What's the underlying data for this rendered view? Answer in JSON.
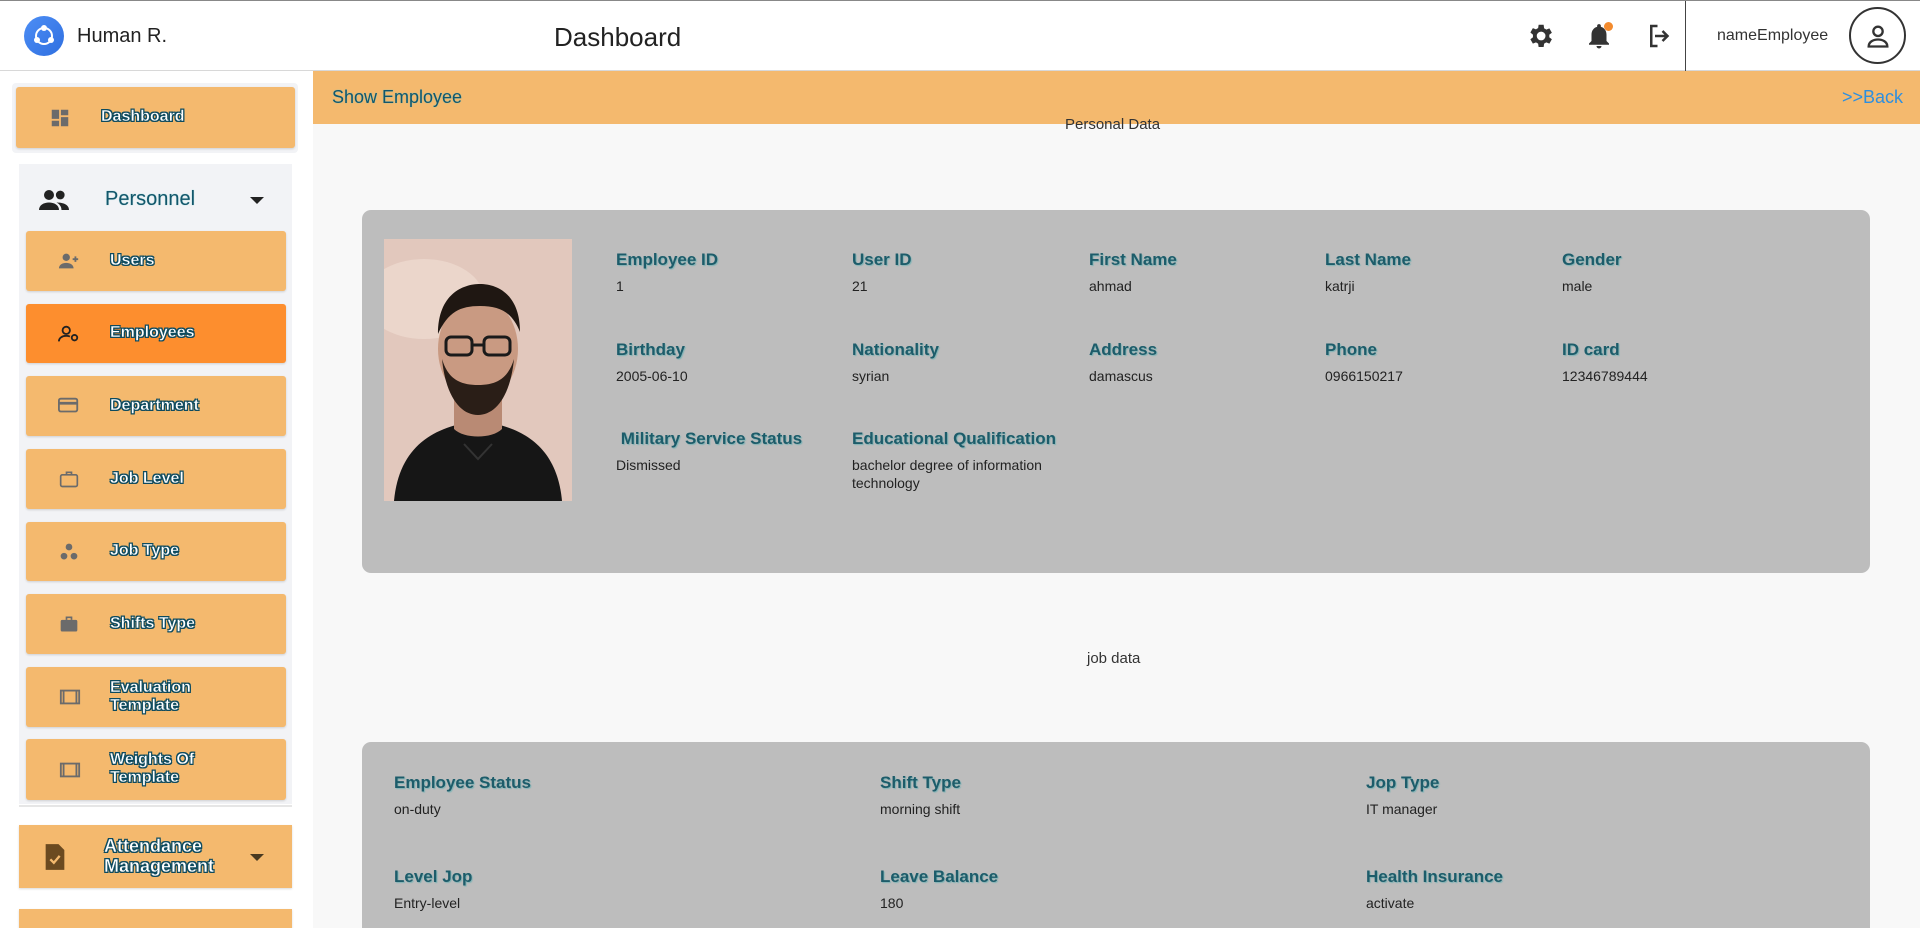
{
  "header": {
    "app_name": "Human R.",
    "page_title": "Dashboard",
    "user_name": "nameEmployee"
  },
  "sidebar": {
    "dashboard_label": "Dashboard",
    "group_label": "Personnel",
    "items": [
      {
        "label": "Users",
        "icon": "add-user-icon"
      },
      {
        "label": "Employees",
        "icon": "employee-settings-icon",
        "active": true
      },
      {
        "label": "Department",
        "icon": "credit-card-icon"
      },
      {
        "label": "Job Level",
        "icon": "briefcase-outline-icon"
      },
      {
        "label": "Job Type",
        "icon": "workspaces-icon"
      },
      {
        "label": "Shifts Type",
        "icon": "briefcase-icon"
      },
      {
        "label": "Evaluation Template",
        "icon": "frame-icon"
      },
      {
        "label": "Weights Of Template",
        "icon": "frame-icon"
      }
    ],
    "group2_label": "Attendance Management"
  },
  "main": {
    "subheader_title": "Show Employee",
    "back_label": ">>Back",
    "personal_section_title": "Personal Data",
    "job_section_title": "job data",
    "personal_fields": [
      {
        "label": "Employee ID",
        "value": "1"
      },
      {
        "label": "User ID",
        "value": "21"
      },
      {
        "label": "First Name",
        "value": "ahmad"
      },
      {
        "label": "Last Name",
        "value": "katrji"
      },
      {
        "label": "Gender",
        "value": "male"
      },
      {
        "label": "Birthday",
        "value": "2005-06-10"
      },
      {
        "label": "Nationality",
        "value": "syrian"
      },
      {
        "label": "Address",
        "value": "damascus"
      },
      {
        "label": "Phone",
        "value": "0966150217"
      },
      {
        "label": "ID card",
        "value": "12346789444"
      },
      {
        "label": " Military Service Status",
        "value": "Dismissed"
      },
      {
        "label": "Educational Qualification",
        "value": "bachelor degree of information technology"
      }
    ],
    "job_fields": [
      {
        "label": "Employee Status",
        "value": "on-duty"
      },
      {
        "label": "Shift Type",
        "value": "morning shift"
      },
      {
        "label": "Jop Type",
        "value": "IT manager"
      },
      {
        "label": "Level Jop",
        "value": "Entry-level"
      },
      {
        "label": "Leave Balance",
        "value": "180"
      },
      {
        "label": "Health Insurance",
        "value": "activate"
      }
    ]
  },
  "colors": {
    "sidebar_button": "#f4b96e",
    "sidebar_active": "#fd8e2e",
    "card": "#bdbdbd",
    "accent_teal": "#1d5c6a",
    "link": "#2d8fe0"
  }
}
